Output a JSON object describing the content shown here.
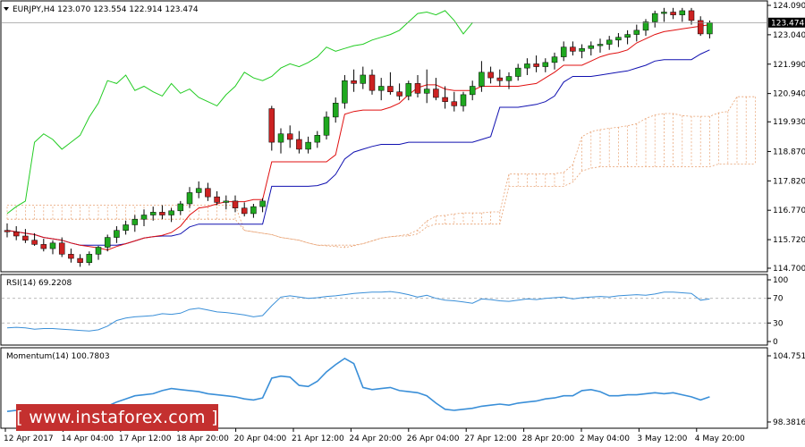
{
  "window": {
    "symbol_header": "EURJPY,H4  123.070 123.554 122.914 123.474"
  },
  "rsi": {
    "header": "RSI(14) 69.2208",
    "levels": [
      "100",
      "70",
      "30",
      "0"
    ]
  },
  "momentum": {
    "header": "Momentum(14) 100.7803",
    "levels": [
      "104.7515",
      "98.3816"
    ]
  },
  "watermark": {
    "text": "[ www.instaforex.com ]"
  },
  "colors": {
    "bull": "#1fa81f",
    "bear": "#cc2222",
    "tenkan": "#e01010",
    "kijun": "#1010b0",
    "chikou": "#22cc22",
    "cloud": "#e8a070",
    "rsi_line": "#3a8fd8",
    "momentum_line": "#3a8fd8",
    "axis": "#000000",
    "level_line": "#b0b0b0",
    "watermark_bg": "#c4302f"
  },
  "chart_data": {
    "type": "candlestick",
    "price_axis": {
      "labels": [
        "124.090",
        "123.040",
        "121.990",
        "120.940",
        "119.930",
        "118.870",
        "117.820",
        "116.770",
        "115.720",
        "114.700"
      ],
      "ylim": [
        114.7,
        124.09
      ],
      "last_price": "123.474"
    },
    "time_axis": [
      "12 Apr 2017",
      "14 Apr 04:00",
      "17 Apr 12:00",
      "18 Apr 20:00",
      "20 Apr 04:00",
      "21 Apr 12:00",
      "24 Apr 20:00",
      "26 Apr 04:00",
      "27 Apr 12:00",
      "28 Apr 20:00",
      "2 May 04:00",
      "3 May 12:00",
      "4 May 20:00"
    ],
    "candles": [
      [
        116.05,
        116.3,
        115.8,
        116.0
      ],
      [
        116.0,
        116.2,
        115.7,
        115.85
      ],
      [
        115.85,
        116.1,
        115.6,
        115.7
      ],
      [
        115.7,
        115.95,
        115.5,
        115.55
      ],
      [
        115.55,
        115.75,
        115.3,
        115.4
      ],
      [
        115.4,
        115.7,
        115.2,
        115.6
      ],
      [
        115.6,
        115.8,
        115.1,
        115.2
      ],
      [
        115.2,
        115.4,
        114.9,
        115.05
      ],
      [
        115.05,
        115.2,
        114.75,
        114.9
      ],
      [
        114.9,
        115.3,
        114.8,
        115.2
      ],
      [
        115.2,
        115.5,
        115.0,
        115.45
      ],
      [
        115.45,
        115.9,
        115.3,
        115.8
      ],
      [
        115.8,
        116.2,
        115.6,
        116.05
      ],
      [
        116.05,
        116.4,
        115.9,
        116.25
      ],
      [
        116.25,
        116.6,
        116.0,
        116.45
      ],
      [
        116.45,
        116.8,
        116.2,
        116.6
      ],
      [
        116.6,
        116.9,
        116.4,
        116.7
      ],
      [
        116.7,
        116.95,
        116.45,
        116.6
      ],
      [
        116.6,
        116.85,
        116.35,
        116.75
      ],
      [
        116.75,
        117.1,
        116.6,
        117.0
      ],
      [
        117.0,
        117.6,
        116.85,
        117.4
      ],
      [
        117.4,
        117.8,
        117.2,
        117.55
      ],
      [
        117.55,
        117.75,
        117.1,
        117.25
      ],
      [
        117.25,
        117.45,
        116.95,
        117.05
      ],
      [
        117.05,
        117.3,
        116.8,
        117.1
      ],
      [
        117.1,
        117.3,
        116.7,
        116.85
      ],
      [
        116.85,
        117.05,
        116.55,
        116.65
      ],
      [
        116.65,
        117.0,
        116.5,
        116.9
      ],
      [
        116.9,
        117.2,
        116.7,
        117.1
      ],
      [
        120.4,
        120.5,
        118.9,
        119.2
      ],
      [
        119.2,
        119.7,
        118.8,
        119.5
      ],
      [
        119.5,
        119.8,
        119.0,
        119.3
      ],
      [
        119.3,
        119.6,
        118.8,
        118.95
      ],
      [
        118.95,
        119.4,
        118.8,
        119.2
      ],
      [
        119.2,
        119.6,
        119.0,
        119.45
      ],
      [
        119.45,
        120.3,
        119.3,
        120.1
      ],
      [
        120.1,
        120.8,
        119.9,
        120.6
      ],
      [
        120.6,
        121.6,
        120.4,
        121.4
      ],
      [
        121.4,
        121.8,
        121.0,
        121.3
      ],
      [
        121.3,
        121.9,
        121.1,
        121.6
      ],
      [
        121.6,
        121.8,
        120.9,
        121.05
      ],
      [
        121.05,
        121.5,
        120.7,
        121.2
      ],
      [
        121.2,
        121.7,
        120.9,
        121.0
      ],
      [
        121.0,
        121.3,
        120.7,
        120.85
      ],
      [
        120.85,
        121.4,
        120.7,
        121.3
      ],
      [
        121.3,
        121.6,
        120.8,
        120.95
      ],
      [
        120.95,
        121.8,
        120.6,
        121.1
      ],
      [
        121.1,
        121.5,
        120.7,
        120.8
      ],
      [
        120.8,
        121.2,
        120.4,
        120.65
      ],
      [
        120.65,
        121.0,
        120.3,
        120.5
      ],
      [
        120.5,
        121.0,
        120.3,
        120.9
      ],
      [
        120.9,
        121.4,
        120.7,
        121.2
      ],
      [
        121.2,
        122.1,
        121.0,
        121.7
      ],
      [
        121.7,
        121.9,
        121.3,
        121.5
      ],
      [
        121.5,
        121.8,
        121.2,
        121.4
      ],
      [
        121.4,
        121.7,
        121.1,
        121.55
      ],
      [
        121.55,
        122.0,
        121.4,
        121.85
      ],
      [
        121.85,
        122.2,
        121.6,
        122.0
      ],
      [
        122.0,
        122.3,
        121.7,
        121.9
      ],
      [
        121.9,
        122.2,
        121.7,
        122.05
      ],
      [
        122.05,
        122.4,
        121.8,
        122.25
      ],
      [
        122.25,
        122.8,
        122.1,
        122.6
      ],
      [
        122.6,
        122.8,
        122.3,
        122.45
      ],
      [
        122.45,
        122.7,
        122.2,
        122.55
      ],
      [
        122.55,
        122.8,
        122.3,
        122.65
      ],
      [
        122.65,
        122.9,
        122.4,
        122.7
      ],
      [
        122.7,
        123.0,
        122.5,
        122.85
      ],
      [
        122.85,
        123.1,
        122.6,
        122.95
      ],
      [
        122.95,
        123.2,
        122.7,
        123.05
      ],
      [
        123.05,
        123.4,
        122.8,
        123.2
      ],
      [
        123.2,
        123.6,
        123.0,
        123.5
      ],
      [
        123.5,
        123.9,
        123.3,
        123.8
      ],
      [
        123.8,
        124.0,
        123.5,
        123.85
      ],
      [
        123.85,
        124.0,
        123.6,
        123.75
      ],
      [
        123.75,
        124.0,
        123.5,
        123.9
      ],
      [
        123.9,
        124.0,
        123.4,
        123.55
      ],
      [
        123.55,
        123.7,
        123.0,
        123.07
      ],
      [
        123.07,
        123.55,
        122.91,
        123.47
      ]
    ],
    "rsi_values": [
      22,
      23,
      22,
      20,
      21,
      21,
      20,
      19,
      18,
      17,
      19,
      25,
      34,
      38,
      40,
      41,
      42,
      45,
      44,
      46,
      52,
      54,
      51,
      48,
      47,
      45,
      43,
      40,
      42,
      58,
      72,
      74,
      72,
      70,
      71,
      73,
      74,
      76,
      78,
      79,
      80,
      80,
      81,
      79,
      76,
      72,
      75,
      70,
      67,
      66,
      64,
      62,
      69,
      68,
      66,
      65,
      67,
      69,
      68,
      70,
      71,
      72,
      69,
      71,
      72,
      73,
      72,
      74,
      75,
      76,
      75,
      77,
      80,
      80,
      79,
      78,
      67,
      69
    ],
    "rsi_ylim": [
      0,
      100
    ],
    "momentum_values": [
      99.4,
      99.5,
      99.4,
      99.5,
      99.6,
      99.6,
      99.5,
      99.4,
      99.3,
      99.4,
      99.6,
      99.9,
      100.3,
      100.6,
      100.9,
      101.0,
      101.1,
      101.4,
      101.6,
      101.5,
      101.4,
      101.3,
      101.1,
      101.0,
      100.9,
      100.8,
      100.6,
      100.5,
      100.7,
      102.6,
      102.8,
      102.7,
      101.9,
      101.8,
      102.3,
      103.2,
      103.9,
      104.5,
      104.0,
      101.7,
      101.5,
      101.6,
      101.7,
      101.4,
      101.3,
      101.2,
      100.9,
      100.2,
      99.6,
      99.5,
      99.6,
      99.7,
      99.9,
      100.0,
      100.1,
      100.0,
      100.2,
      100.3,
      100.4,
      100.6,
      100.7,
      100.9,
      100.9,
      101.4,
      101.5,
      101.3,
      100.9,
      100.9,
      101.0,
      101.0,
      101.1,
      101.2,
      101.1,
      101.2,
      101.0,
      100.8,
      100.5,
      100.8
    ],
    "momentum_ylim": [
      98.3816,
      104.7515
    ]
  }
}
